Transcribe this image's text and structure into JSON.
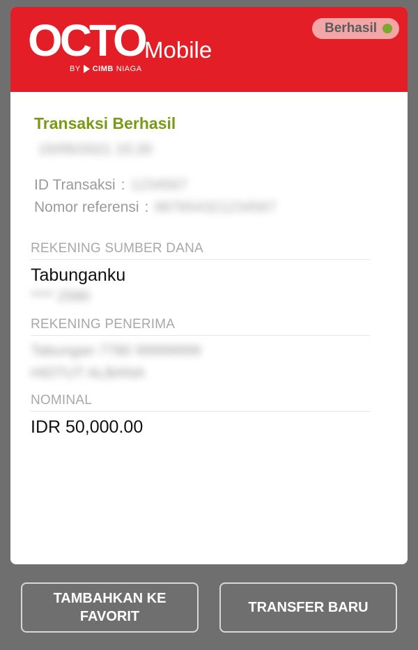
{
  "header": {
    "logo_octo": "OCTO",
    "logo_mobile": "Mobile",
    "logo_by": "BY",
    "logo_cimb": "CIMB",
    "logo_niaga": "NIAGA",
    "status_label": "Berhasil",
    "colors": {
      "brand": "#e41e26",
      "status_dot": "#7ca830"
    }
  },
  "receipt": {
    "title": "Transaksi Berhasil",
    "date_blurred": "15/05/2021 15:20",
    "transaction_id_label": "ID Transaksi",
    "transaction_id_value": "1234567",
    "reference_label": "Nomor referensi",
    "reference_value": "987654321234567",
    "source": {
      "label": "REKENING SUMBER DANA",
      "account_type": "Tabunganku",
      "account_masked": "**** 2580"
    },
    "recipient": {
      "label": "REKENING PENERIMA",
      "line1": "Tabungan 7780 99999999",
      "line2": "HIDTUT ALBANA"
    },
    "amount": {
      "label": "NOMINAL",
      "value": "IDR 50,000.00"
    }
  },
  "actions": {
    "favorite_label": "TAMBAHKAN KE FAVORIT",
    "new_transfer_label": "TRANSFER BARU"
  }
}
